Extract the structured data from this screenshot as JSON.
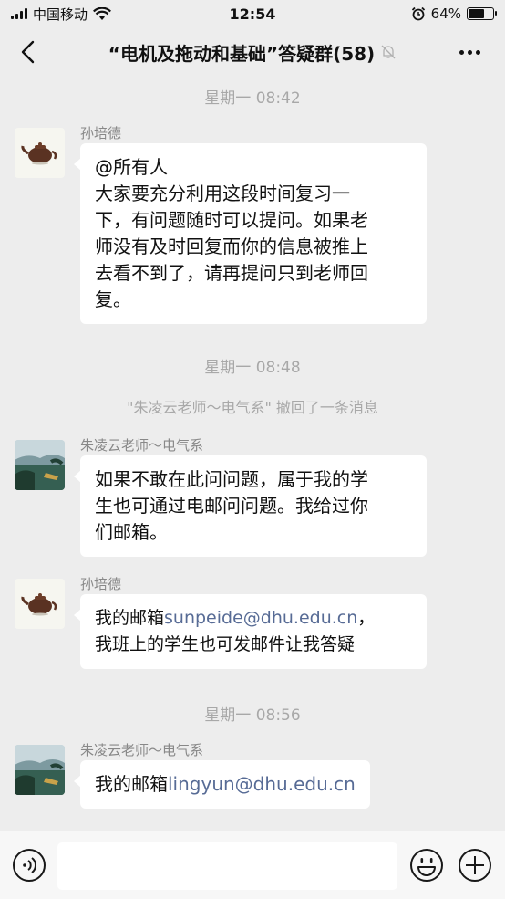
{
  "status_bar": {
    "carrier": "中国移动",
    "time": "12:54",
    "battery": "64%",
    "battery_level": 0.64
  },
  "header": {
    "title": "“电机及拖动和基础”答疑群(58)",
    "back_icon": "chevron-left-icon",
    "mute_icon": "bell-off-icon",
    "more_icon": "more-dots-icon"
  },
  "chat": {
    "timestamps": [
      "星期一 08:42",
      "星期一 08:48",
      "星期一 08:56"
    ],
    "system_message": "\"朱凌云老师～电气系\" 撤回了一条消息",
    "messages": [
      {
        "sender": "孙培德",
        "lines": [
          "@所有人",
          "大家要充分利用这段时间复习一",
          "下，有问题随时可以提问。如果老",
          "师没有及时回复而你的信息被推上",
          "去看不到了，请再提问只到老师回",
          "复。"
        ]
      },
      {
        "sender": "朱凌云老师～电气系",
        "lines": [
          "如果不敢在此问问题，属于我的学",
          "生也可通过电邮问问题。我给过你",
          "们邮箱。"
        ]
      },
      {
        "sender": "孙培德",
        "line1_prefix": "我的邮箱",
        "line1_link": "sunpeide@dhu.edu.cn",
        "line1_suffix": "，",
        "line2": "我班上的学生也可发邮件让我答疑"
      },
      {
        "sender": "朱凌云老师～电气系",
        "prefix": "我的邮箱",
        "link": "lingyun@dhu.edu.cn"
      }
    ]
  },
  "input_bar": {
    "voice_icon": "voice-icon",
    "emoji_icon": "emoji-icon",
    "plus_icon": "plus-icon",
    "text_value": ""
  },
  "colors": {
    "background": "#ededed",
    "bubble": "#ffffff",
    "link": "#576b95",
    "meta_text": "#a8a8a8"
  }
}
